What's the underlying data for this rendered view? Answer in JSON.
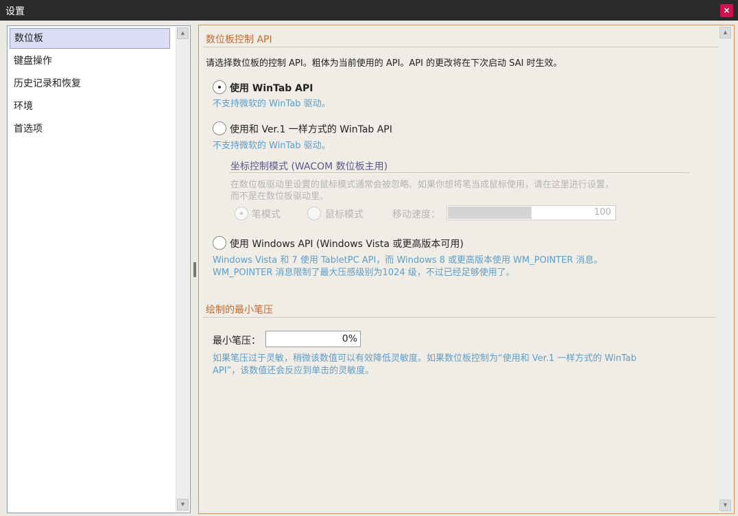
{
  "window": {
    "title": "设置",
    "close_label": "×"
  },
  "sidebar": {
    "items": [
      {
        "label": "数位板",
        "selected": true
      },
      {
        "label": "键盘操作"
      },
      {
        "label": "历史记录和恢复"
      },
      {
        "label": "环境"
      },
      {
        "label": "首选项"
      }
    ]
  },
  "tablet_api": {
    "section_title": "数位板控制 API",
    "description": "请选择数位板的控制 API。粗体为当前使用的 API。API 的更改将在下次启动 SAI 时生效。",
    "options": [
      {
        "label": "使用 WinTab API",
        "note": "不支持微软的 WinTab 驱动。",
        "checked": true
      },
      {
        "label": "使用和 Ver.1 一样方式的 WinTab API",
        "note": "不支持微软的 WinTab 驱动。",
        "checked": false
      },
      {
        "label": "使用 Windows API (Windows Vista 或更高版本可用)",
        "note_line1": "Windows Vista 和 7 使用 TabletPC API，而 Windows 8 或更高版本使用 WM_POINTER 消息。",
        "note_line2": "WM_POINTER 消息限制了最大压感级别为1024 级，不过已经足够使用了。",
        "checked": false
      }
    ],
    "coord_mode": {
      "title": "坐标控制模式 (WACOM 数位板主用)",
      "desc_line1": "在数位板驱动里设置的鼠标模式通常会被忽略。如果你想将笔当成鼠标使用，请在这里进行设置，",
      "desc_line2": "而不是在数位板驱动里。",
      "pen_mode_label": "笔模式",
      "mouse_mode_label": "鼠标模式",
      "speed_label": "移动速度：",
      "speed_value": "100",
      "speed_fill_fraction": 0.5
    }
  },
  "min_pressure": {
    "section_title": "绘制的最小笔压",
    "label": "最小笔压：",
    "value": "0%",
    "note_line1": "如果笔压过于灵敏，稍微该数值可以有效降低灵敏度。如果数位板控制为“使用和 Ver.1 一样方式的 WinTab",
    "note_line2": "API”，该数值还会反应到单击的灵敏度。"
  },
  "icons": {
    "close": "close-icon",
    "scroll_up": "arrow-up-icon",
    "scroll_down": "arrow-down-icon"
  },
  "colors": {
    "title_bar": "#2a2a2a",
    "close_button": "#d0114f",
    "section_title": "#c06a2e",
    "note_text": "#5d9ec9",
    "panel_border": "#d4924f"
  }
}
